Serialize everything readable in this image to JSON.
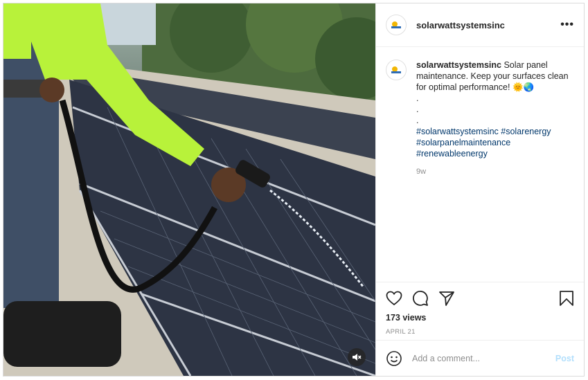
{
  "post": {
    "username": "solarwattsystemsinc",
    "more_label": "•••",
    "caption_username": "solarwattsystemsinc",
    "caption_text": "Solar panel maintenance. Keep your surfaces clean for optimal performance! 🌞🌏",
    "dots": [
      ".",
      ".",
      "."
    ],
    "hashtags": [
      "#solarwattsystemsinc",
      "#solarenergy",
      "#solarpanelmaintenance",
      "#renewableenergy"
    ],
    "time_ago": "9w",
    "views": "173 views",
    "date": "APRIL 21",
    "comment_placeholder": "Add a comment...",
    "post_label": "Post"
  },
  "colors": {
    "link": "#00376b",
    "post_button": "#b2dffc",
    "muted": "#8e8e8e",
    "border": "#dbdbdb"
  },
  "icons": {
    "like": "heart-icon",
    "comment": "comment-icon",
    "share": "send-icon",
    "save": "bookmark-icon",
    "mute": "speaker-muted-icon",
    "emoji": "smiley-icon",
    "more": "more-options-icon"
  }
}
